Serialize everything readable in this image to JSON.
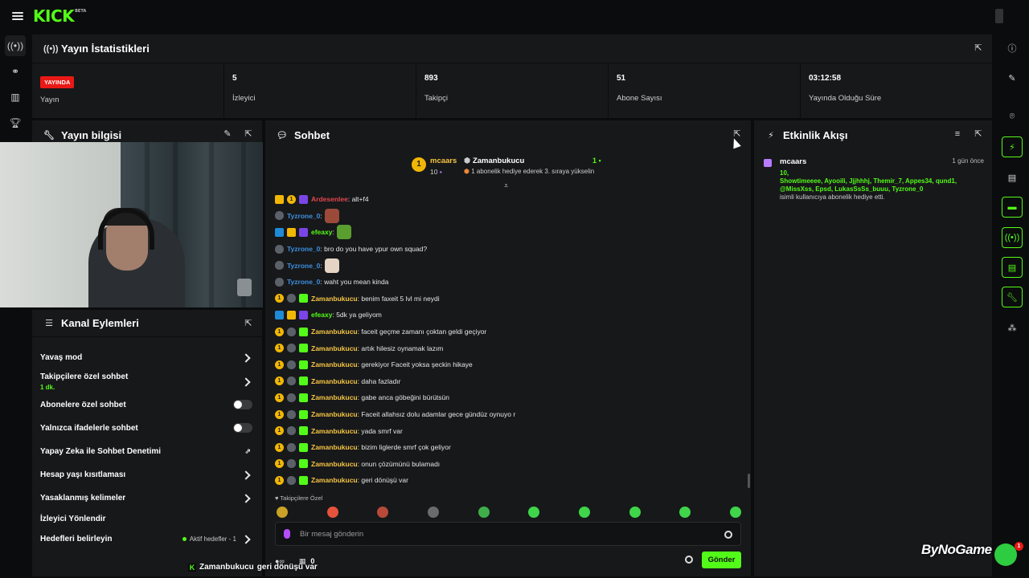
{
  "brand": {
    "logo": "KICK",
    "beta": "BETA"
  },
  "stats": {
    "title": "Yayın İstatistikleri",
    "live_badge": "YAYINDA",
    "items": [
      {
        "value": "",
        "label": "Yayın"
      },
      {
        "value": "5",
        "label": "İzleyici"
      },
      {
        "value": "893",
        "label": "Takipçi"
      },
      {
        "value": "51",
        "label": "Abone Sayısı"
      },
      {
        "value": "03:12:58",
        "label": "Yayında Olduğu Süre"
      }
    ]
  },
  "stream_info": {
    "title": "Yayın bilgisi"
  },
  "channel_actions": {
    "title": "Kanal Eylemleri",
    "items": [
      {
        "label": "Yavaş mod",
        "control": "chevron"
      },
      {
        "label": "Takipçilere özel sohbet",
        "sub": "1 dk.",
        "control": "chevron"
      },
      {
        "label": "Abonelere özel sohbet",
        "control": "toggle",
        "on": false
      },
      {
        "label": "Yalnızca ifadelerle sohbet",
        "control": "toggle",
        "on": false
      },
      {
        "label": "Yapay Zeka ile Sohbet Denetimi",
        "control": "external"
      },
      {
        "label": "Hesap yaşı kısıtlaması",
        "control": "chevron"
      },
      {
        "label": "Yasaklanmış kelimeler",
        "control": "chevron"
      },
      {
        "label": "İzleyici Yönlendir",
        "control": "none"
      },
      {
        "label": "Hedefleri belirleyin",
        "status": "Aktif hedefler - 1",
        "control": "chevron"
      }
    ]
  },
  "chat": {
    "title": "Sohbet",
    "pinned": {
      "rank": "1",
      "gifter": "mcaars",
      "gift_count": "10",
      "recipient": "Zamanbukucu",
      "recipient_count": "1",
      "message": "1 abonelik hediye ederek 3. sıraya yükselin"
    },
    "messages": [
      {
        "badges": [
          "crown",
          "coin",
          "purple"
        ],
        "user": "Ardesenlee",
        "color": "#e0464f",
        "text": ": alt+f4",
        "emote": ""
      },
      {
        "badges": [
          "shield"
        ],
        "user": "Tyzrone_0",
        "color": "#3d8fe0",
        "text": ":",
        "emote": "#9b4a3a"
      },
      {
        "badges": [
          "blue",
          "crown",
          "purple"
        ],
        "user": "efeaxy",
        "color": "#53fc18",
        "text": ":",
        "emote": "#5a9e2f"
      },
      {
        "badges": [
          "shield"
        ],
        "user": "Tyzrone_0",
        "color": "#3d8fe0",
        "text": ": bro do you have ypur own squad?",
        "emote": ""
      },
      {
        "badges": [
          "shield"
        ],
        "user": "Tyzrone_0",
        "color": "#3d8fe0",
        "text": ":",
        "emote": "#e6d4c4"
      },
      {
        "badges": [
          "shield"
        ],
        "user": "Tyzrone_0",
        "color": "#3d8fe0",
        "text": ": waht you mean kinda",
        "emote": ""
      },
      {
        "badges": [
          "coin",
          "shield",
          "gift"
        ],
        "user": "Zamanbukucu",
        "color": "#f5c542",
        "text": ": benim faxeit 5 lvl mi neydi",
        "emote": ""
      },
      {
        "badges": [
          "blue",
          "crown",
          "purple"
        ],
        "user": "efeaxy",
        "color": "#53fc18",
        "text": ": 5dk ya geliyom",
        "emote": ""
      },
      {
        "badges": [
          "coin",
          "shield",
          "gift"
        ],
        "user": "Zamanbukucu",
        "color": "#f5c542",
        "text": ": faceit geçme zamanı çoktan geldi geçiyor",
        "emote": ""
      },
      {
        "badges": [
          "coin",
          "shield",
          "gift"
        ],
        "user": "Zamanbukucu",
        "color": "#f5c542",
        "text": ": artık hilesiz oynamak lazım",
        "emote": ""
      },
      {
        "badges": [
          "coin",
          "shield",
          "gift"
        ],
        "user": "Zamanbukucu",
        "color": "#f5c542",
        "text": ": gerekiyor Faceit yoksa şeckin hikaye",
        "emote": ""
      },
      {
        "badges": [
          "coin",
          "shield",
          "gift"
        ],
        "user": "Zamanbukucu",
        "color": "#f5c542",
        "text": ": daha fazladır",
        "emote": ""
      },
      {
        "badges": [
          "coin",
          "shield",
          "gift"
        ],
        "user": "Zamanbukucu",
        "color": "#f5c542",
        "text": ": gabe anca göbeğini bürütsün",
        "emote": ""
      },
      {
        "badges": [
          "coin",
          "shield",
          "gift"
        ],
        "user": "Zamanbukucu",
        "color": "#f5c542",
        "text": ": Faceit allahsız dolu adamlar gece gündüz oynuyo r",
        "emote": ""
      },
      {
        "badges": [
          "coin",
          "shield",
          "gift"
        ],
        "user": "Zamanbukucu",
        "color": "#f5c542",
        "text": ": yada smrf var",
        "emote": ""
      },
      {
        "badges": [
          "coin",
          "shield",
          "gift"
        ],
        "user": "Zamanbukucu",
        "color": "#f5c542",
        "text": ": bizim liglerde smrf çok geliyor",
        "emote": ""
      },
      {
        "badges": [
          "coin",
          "shield",
          "gift"
        ],
        "user": "Zamanbukucu",
        "color": "#f5c542",
        "text": ": onun çözümünü bulamadı",
        "emote": ""
      },
      {
        "badges": [
          "coin",
          "shield",
          "gift"
        ],
        "user": "Zamanbukucu",
        "color": "#f5c542",
        "text": ": geri dönüşü var",
        "emote": ""
      }
    ],
    "emote_label": "Takipçilere Özel",
    "emote_colors": [
      "#c9a227",
      "#e6533c",
      "#b84a3a",
      "#6b6b6b",
      "#3fae4a",
      "#3fd44a",
      "#3fd44a",
      "#3fd44a",
      "#3fd44a",
      "#3fd44a"
    ],
    "input_placeholder": "Bir mesaj gönderin",
    "viewer_count": "0",
    "send_label": "Gönder"
  },
  "activity": {
    "title": "Etkinlik Akışı",
    "user": "mcaars",
    "time": "1 gün önce",
    "count": "10,",
    "recipients": "Showtimeeee, Ayooili, Jjjhhhj, Themir_7, Appes34, qund1, @MissXss, Epsd, LukasSsSs_buuu, Tyzrone_0",
    "description": "isimli kullanıcıya abonelik hediye etti."
  },
  "overlay": {
    "user": "Zamanbukucu",
    "text": "geri dönüşü var"
  },
  "sponsor": {
    "name": "ByNoGame",
    "badge": "1"
  }
}
